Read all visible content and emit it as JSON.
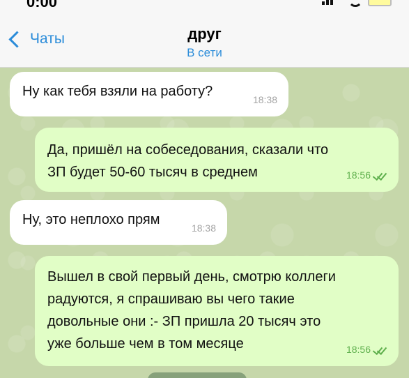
{
  "status_bar": {
    "time": "0:00"
  },
  "header": {
    "back_label": "Чаты",
    "title": "друг",
    "status": "В сети"
  },
  "messages": [
    {
      "direction": "incoming",
      "text": "Ну как тебя взяли на работу?",
      "time": "18:38"
    },
    {
      "direction": "outgoing",
      "text": "Да, пришёл на собеседования, сказали что\nЗП будет 50-60 тысяч в среднем",
      "time": "18:56",
      "read": true
    },
    {
      "direction": "incoming",
      "text": "Ну, это неплохо прям",
      "time": "18:38"
    },
    {
      "direction": "outgoing",
      "text": "Вышел в свой первый день, смотрю коллеги\nрадуются, я спрашиваю вы чего такие\nдовольные они :- ЗП пришла 20 тысяч это\nуже больше чем в том месяце",
      "time": "18:56",
      "read": true
    }
  ],
  "colors": {
    "accent": "#2b8cd9",
    "incoming_bubble": "#ffffff",
    "outgoing_bubble": "#e1fec6",
    "read_check": "#5fb04d",
    "chat_background": "#c6d7aa"
  },
  "icons": {
    "back": "chevron-left-icon",
    "read": "double-check-icon",
    "signal": "signal-icon",
    "wifi": "wifi-icon",
    "battery": "battery-icon"
  }
}
